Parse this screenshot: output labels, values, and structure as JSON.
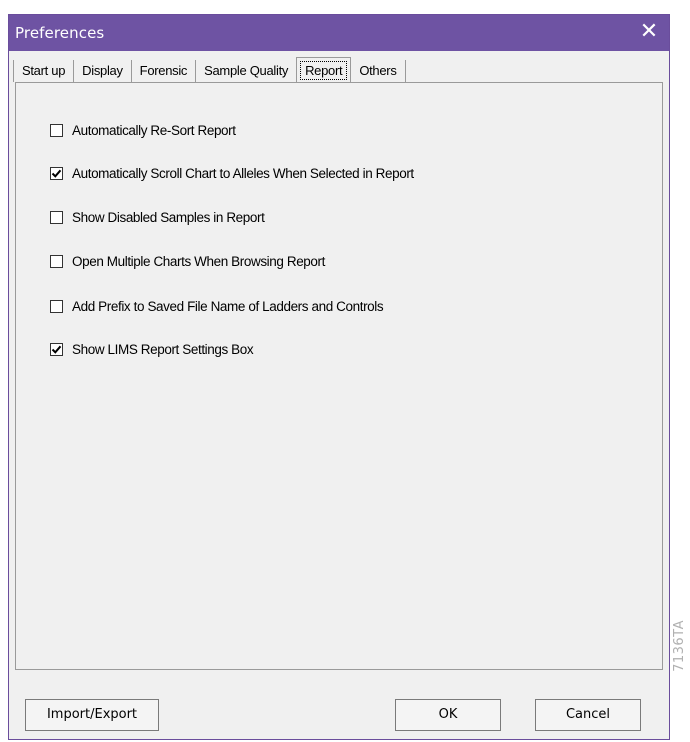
{
  "window": {
    "title": "Preferences",
    "close_glyph": "✕",
    "titlebar_color": "#6e53a3"
  },
  "tabs": [
    {
      "label": "Start up",
      "active": false
    },
    {
      "label": "Display",
      "active": false
    },
    {
      "label": "Forensic",
      "active": false
    },
    {
      "label": "Sample Quality",
      "active": false
    },
    {
      "label": "Report",
      "active": true
    },
    {
      "label": "Others",
      "active": false
    }
  ],
  "options": [
    {
      "label": "Automatically Re-Sort Report",
      "checked": false
    },
    {
      "label": "Automatically Scroll Chart to Alleles When Selected in Report",
      "checked": true
    },
    {
      "label": "Show Disabled Samples in Report",
      "checked": false
    },
    {
      "label": "Open Multiple Charts When Browsing Report",
      "checked": false
    },
    {
      "label": "Add Prefix to Saved File Name of Ladders and Controls",
      "checked": false
    },
    {
      "label": "Show LIMS Report Settings Box",
      "checked": true
    }
  ],
  "buttons": {
    "import_export": "Import/Export",
    "ok": "OK",
    "cancel": "Cancel"
  },
  "figure_code": "7136TA"
}
